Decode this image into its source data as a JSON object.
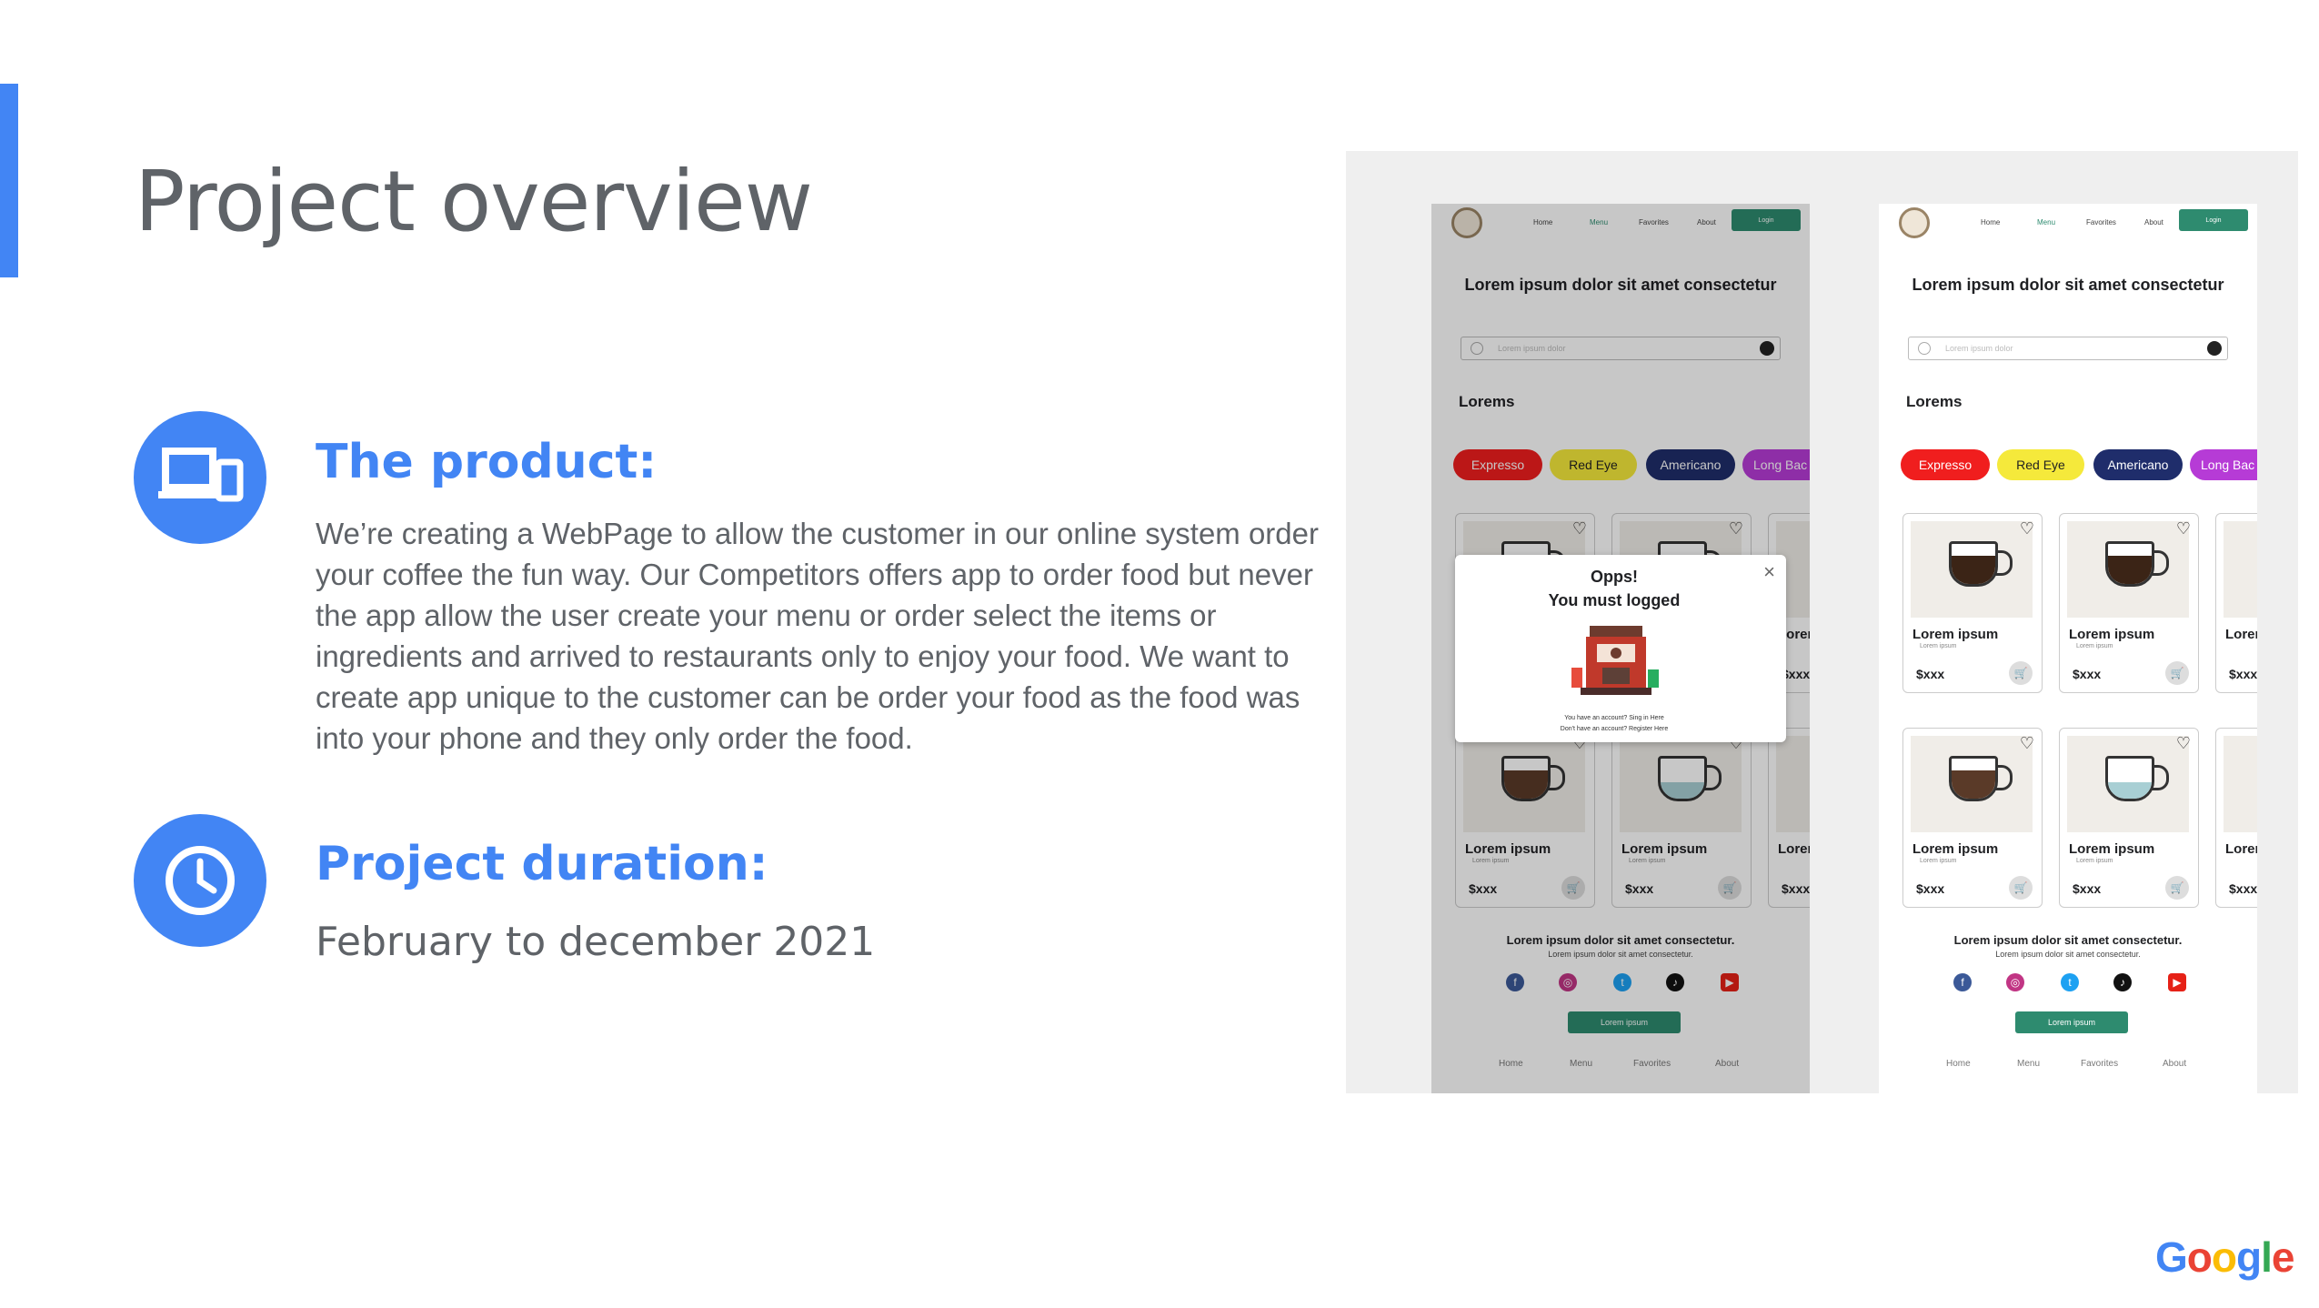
{
  "slide": {
    "title": "Project overview",
    "product_heading": "The product:",
    "product_body": "We’re creating a WebPage  to  allow the customer in our online system order your coffee the fun way. Our Competitors offers app to order food but never the app allow the user create your menu or order select the items or ingredients and arrived to restaurants only to enjoy your food. We want to create app unique to the customer can be order your food as the food was into your phone and they only order the food.",
    "duration_heading": "Project duration:",
    "duration_value": "February to december 2021",
    "accent_color": "#4285f4",
    "icons": [
      "devices-icon",
      "clock-icon"
    ]
  },
  "mockup": {
    "nav": [
      "Home",
      "Menu",
      "Favorites",
      "About"
    ],
    "login": "Login",
    "hero": "Lorem ipsum dolor sit amet consectetur",
    "search_placeholder": "Lorem ipsum dolor",
    "section": "Lorems",
    "chips": [
      {
        "label": "Expresso",
        "color": "#f01e1e"
      },
      {
        "label": "Red Eye",
        "color": "#f5e93b"
      },
      {
        "label": "Americano",
        "color": "#1f2d6b"
      },
      {
        "label": "Long Bac",
        "color": "#b63bd6"
      }
    ],
    "card_name": "Lorem ipsum",
    "card_sub": "Lorem ipsum",
    "card_price": "$xxx",
    "footer_title": "Lorem ipsum dolor sit amet consectetur.",
    "footer_sub": "Lorem ipsum dolor sit amet consectetur.",
    "footer_button": "Lorem ipsum",
    "social_icons": [
      "facebook-icon",
      "instagram-icon",
      "twitter-icon",
      "tiktok-icon",
      "youtube-icon"
    ],
    "modal": {
      "line1": "Opps!",
      "line2": "You must logged",
      "note1": "You have an account? Sing in Here",
      "note2": "Don't have an account? Register Here"
    }
  },
  "brand": {
    "logo_letters": [
      "G",
      "o",
      "o",
      "g",
      "l",
      "e"
    ],
    "logo_colors": [
      "#4285f4",
      "#ea4335",
      "#fbbc05",
      "#4285f4",
      "#34a853",
      "#ea4335"
    ]
  }
}
